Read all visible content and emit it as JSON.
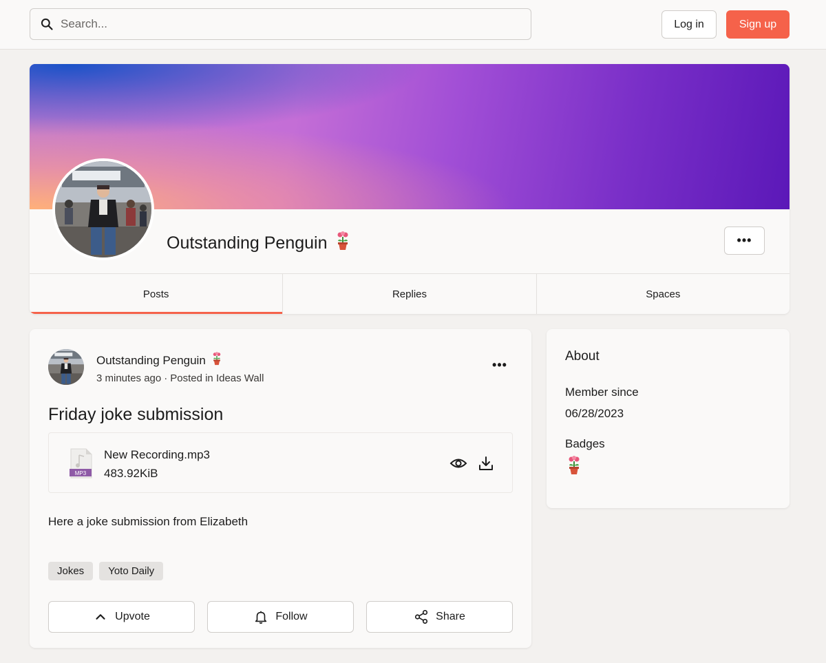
{
  "header": {
    "search_placeholder": "Search...",
    "login_label": "Log in",
    "signup_label": "Sign up",
    "accent_color": "#f5624a"
  },
  "profile": {
    "name": "Outstanding Penguin",
    "badge_icon": "flower-pot-icon",
    "more_icon": "more-horizontal-icon",
    "tabs": [
      {
        "label": "Posts",
        "active": true
      },
      {
        "label": "Replies",
        "active": false
      },
      {
        "label": "Spaces",
        "active": false
      }
    ]
  },
  "post": {
    "author": "Outstanding Penguin",
    "time": "3 minutes ago",
    "separator": "·",
    "posted_in": "Posted in Ideas Wall",
    "title": "Friday joke submission",
    "attachment": {
      "file_name": "New Recording.mp3",
      "file_size": "483.92KiB",
      "file_type": "MP3"
    },
    "body": "Here a joke submission from Elizabeth",
    "tags": [
      "Jokes",
      "Yoto Daily"
    ],
    "actions": {
      "upvote": "Upvote",
      "follow": "Follow",
      "share": "Share"
    }
  },
  "about": {
    "title": "About",
    "member_since_label": "Member since",
    "member_since_value": "06/28/2023",
    "badges_label": "Badges"
  }
}
